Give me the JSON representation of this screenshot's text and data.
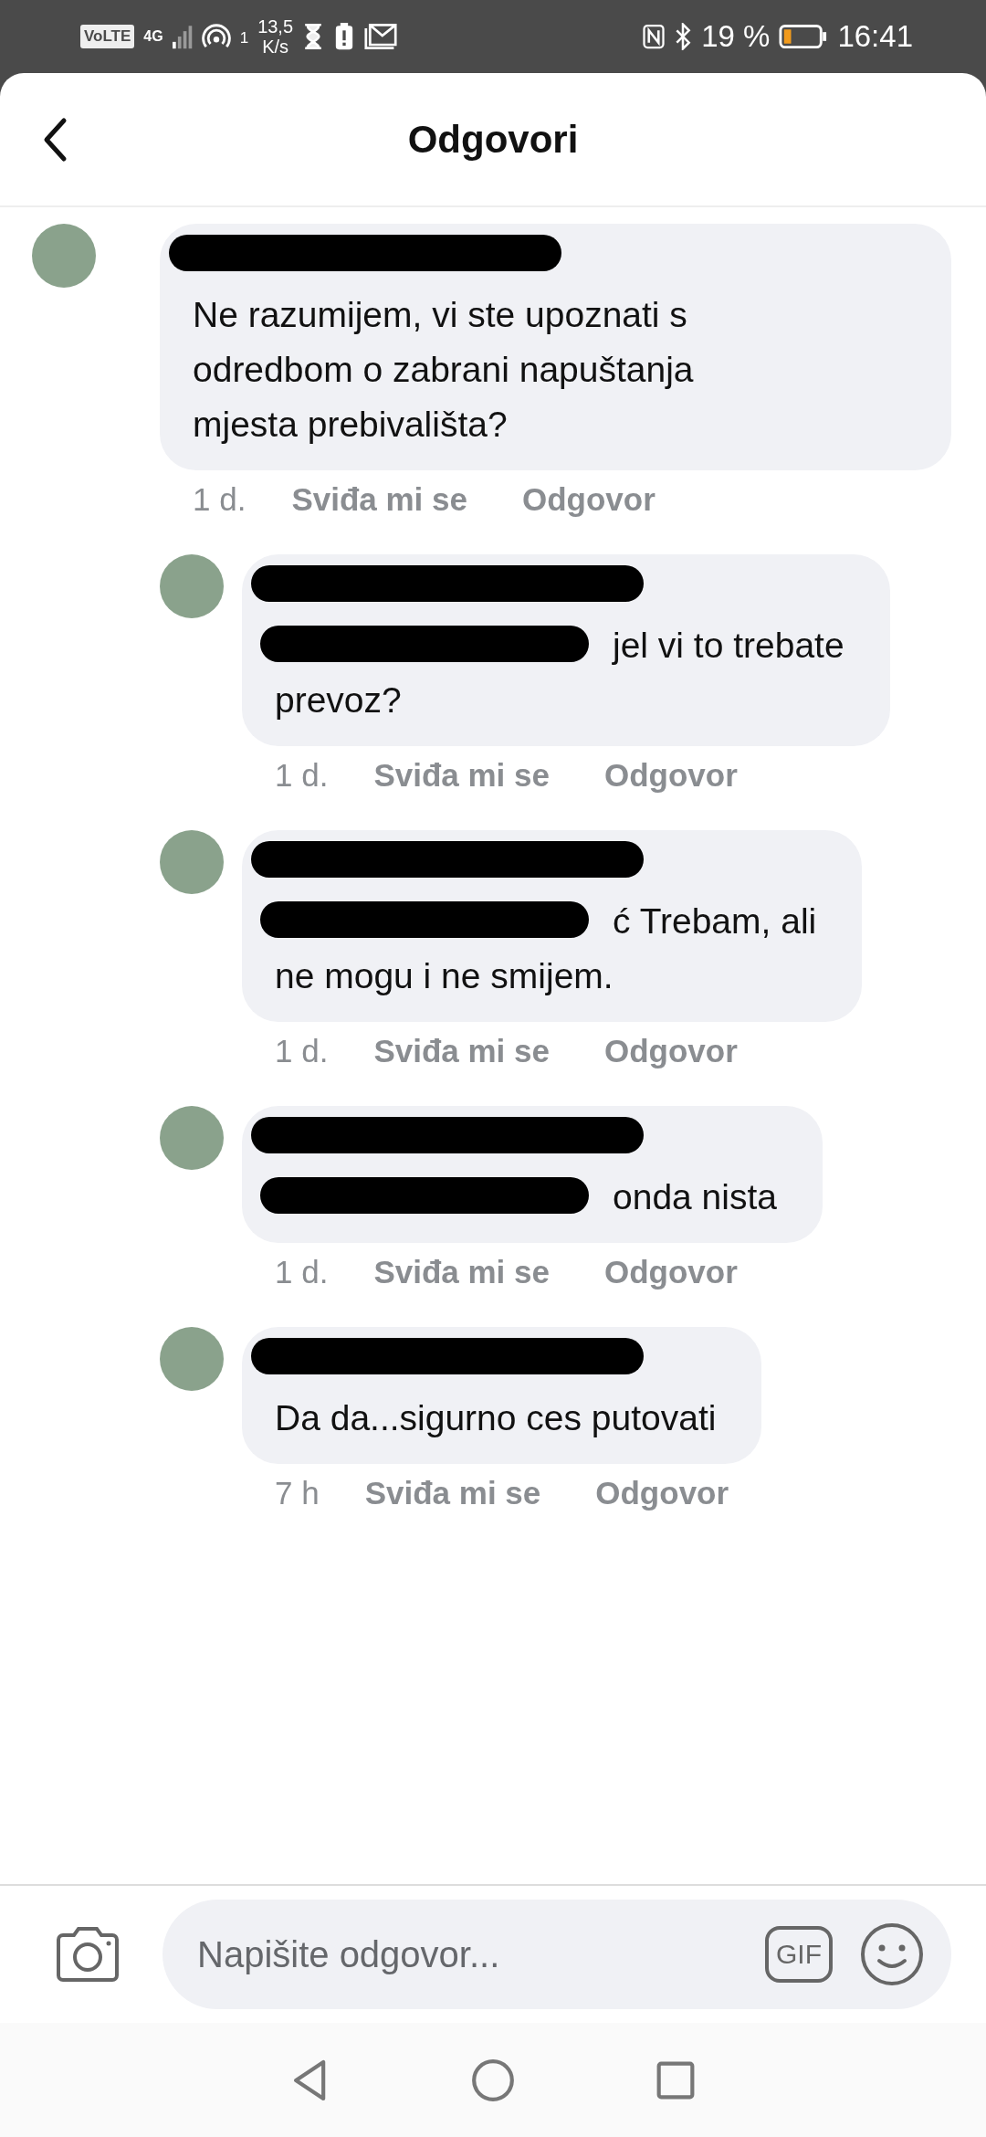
{
  "status_bar": {
    "network_badge": "VoLTE",
    "network_type": "4G",
    "hotspot_count": "1",
    "speed_value": "13,5",
    "speed_unit": "K/s",
    "battery_percent": "19 %",
    "time": "16:41"
  },
  "header": {
    "title": "Odgovori"
  },
  "comments": [
    {
      "reply": false,
      "redacted_mention": false,
      "lines": [
        "Ne razumijem, vi ste upoznati s",
        "odredbom o zabrani napuštanja",
        "mjesta prebivališta?"
      ],
      "time": "1 d.",
      "like": "Sviđa mi se",
      "answer": "Odgovor"
    },
    {
      "reply": true,
      "redacted_mention": true,
      "lines": [
        "jel vi to trebate",
        "prevoz?"
      ],
      "time": "1 d.",
      "like": "Sviđa mi se",
      "answer": "Odgovor"
    },
    {
      "reply": true,
      "redacted_mention": true,
      "lines": [
        "ć Trebam, ali",
        "ne mogu i ne smijem."
      ],
      "time": "1 d.",
      "like": "Sviđa mi se",
      "answer": "Odgovor"
    },
    {
      "reply": true,
      "redacted_mention": true,
      "lines": [
        "onda nista"
      ],
      "time": "1 d.",
      "like": "Sviđa mi se",
      "answer": "Odgovor"
    },
    {
      "reply": true,
      "redacted_mention": false,
      "lines": [
        "Da da...sigurno ces putovati"
      ],
      "time": "7 h",
      "like": "Sviđa mi se",
      "answer": "Odgovor"
    }
  ],
  "composer": {
    "placeholder": "Napišite odgovor...",
    "gif_label": "GIF"
  }
}
